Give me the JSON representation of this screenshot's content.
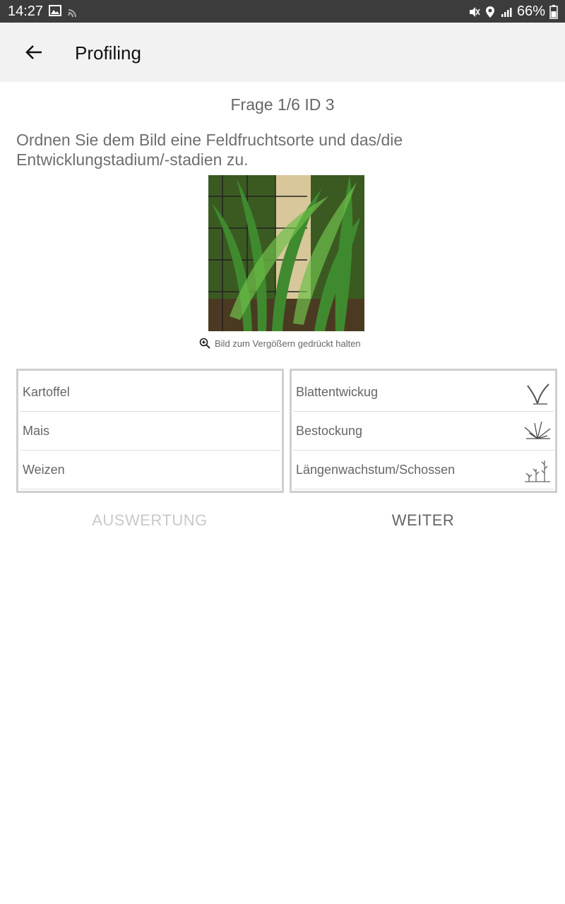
{
  "status_bar": {
    "time": "14:27",
    "battery": "66%",
    "icons_left": [
      "image-icon",
      "cast-icon"
    ],
    "icons_right": [
      "mute-icon",
      "location-icon",
      "signal-icon",
      "battery-icon"
    ]
  },
  "app_bar": {
    "title": "Profiling",
    "back_icon": "arrow-left-icon"
  },
  "question": {
    "header": "Frage 1/6 ID 3",
    "prompt": "Ordnen Sie dem Bild eine Feldfruchtsorte und das/die Entwicklungstadium/-stadien zu.",
    "zoom_hint": "Bild zum Vergößern gedrückt halten"
  },
  "crops": [
    {
      "label": "Kartoffel"
    },
    {
      "label": "Mais"
    },
    {
      "label": "Weizen"
    }
  ],
  "stages": [
    {
      "label": "Blattentwickug",
      "icon": "leaf-sprout-icon"
    },
    {
      "label": "Bestockung",
      "icon": "tillering-icon"
    },
    {
      "label": "Längenwachstum/Schossen",
      "icon": "stem-growth-icon"
    }
  ],
  "actions": {
    "evaluate_label": "AUSWERTUNG",
    "next_label": "WEITER"
  },
  "colors": {
    "status_bar": "#3c3c3c",
    "app_bar": "#f2f2f2",
    "text_muted": "#666666",
    "disabled": "#c9c9c9"
  }
}
